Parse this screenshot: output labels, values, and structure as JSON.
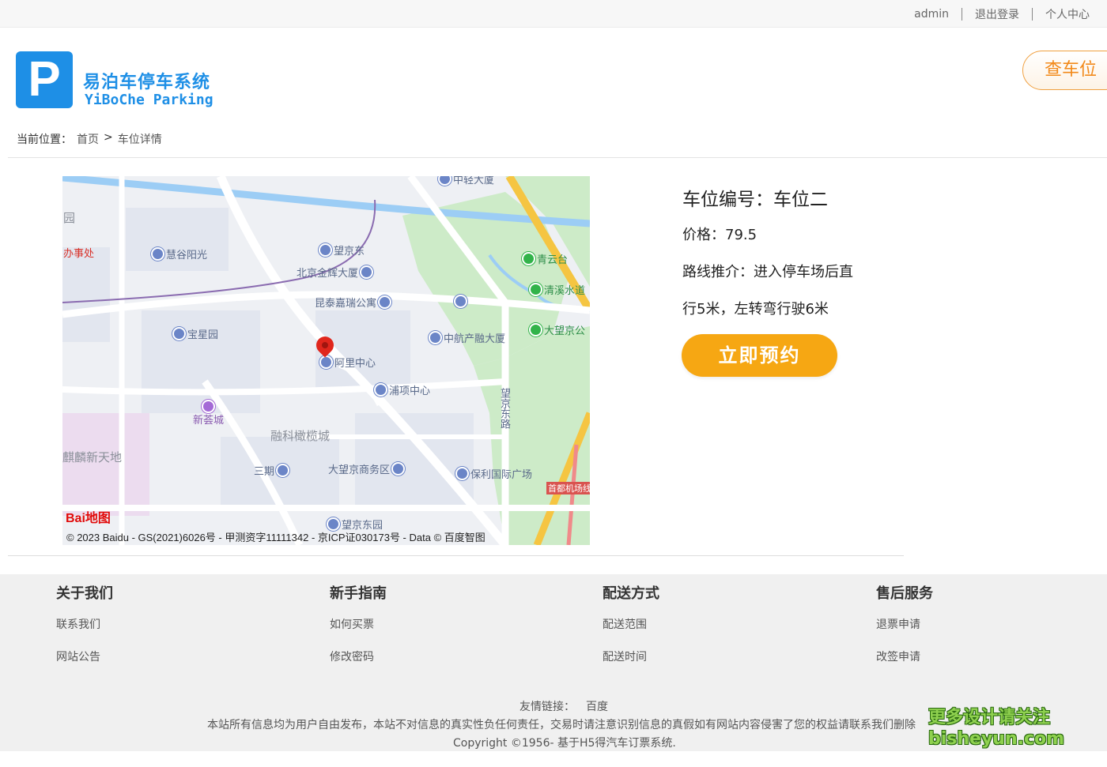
{
  "topbar": {
    "user": "admin",
    "logout": "退出登录",
    "profile": "个人中心"
  },
  "brand": {
    "logo_letter": "P",
    "name_cn": "易泊车停车系统",
    "name_en": "YiBoChe  Parking"
  },
  "header": {
    "search_button": "查车位"
  },
  "breadcrumb": {
    "prefix": "当前位置：",
    "home": "首页",
    "separator": ">",
    "current": "车位详情"
  },
  "map": {
    "brand_logo": "Bai地图",
    "copyright": "© 2023 Baidu - GS(2021)6026号 - 甲测资字11111342 - 京ICP证030173号 - Data © 百度智图",
    "pois": {
      "zhongqing": "中轻大厦",
      "wangjingdong": "望京东",
      "beijing_jinhui": "北京金辉大厦",
      "kuntai": "昆泰嘉瑞公寓",
      "huigu": "慧谷阳光",
      "banshichu": "办事处",
      "yuan": "园",
      "qingyuntai": "青云台",
      "qingxi": "清溪水道",
      "dawangjing_park": "大望京公",
      "zhonghang": "中航产融大厦",
      "baoxingyuan": "宝星园",
      "alibaba": "阿里中心",
      "puxiang": "浦项中心",
      "wangjing_road": "望京东路",
      "xinhuicheng": "新荟城",
      "rongke": "融科橄榄城",
      "qilin": "麒麟新天地",
      "sanqi": "三期",
      "dawangjing_biz": "大望京商务区",
      "baoli": "保利国际广场",
      "airport": "首都机场线",
      "wangjingdongyuan": "望京东园"
    }
  },
  "detail": {
    "title": "车位编号：车位二",
    "price": "价格：79.5",
    "route_line1": "路线推介：进入停车场后直",
    "route_line2": "行5米，左转弯行驶6米",
    "reserve_button": "立即预约"
  },
  "footer": {
    "columns": [
      {
        "title": "关于我们",
        "links": [
          "联系我们",
          "网站公告"
        ]
      },
      {
        "title": "新手指南",
        "links": [
          "如何买票",
          "修改密码"
        ]
      },
      {
        "title": "配送方式",
        "links": [
          "配送范围",
          "配送时间"
        ]
      },
      {
        "title": "售后服务",
        "links": [
          "退票申请",
          "改签申请"
        ]
      }
    ],
    "friend_label": "友情链接：",
    "friend_link": "百度",
    "disclaimer": "本站所有信息均为用户自由发布，本站不对信息的真实性负任何责任，交易时请注意识别信息的真假如有网站内容侵害了您的权益请联系我们删除",
    "copyright": "Copyright ©1956- 基于H5得汽车订票系统."
  },
  "watermark": {
    "line1": "更多设计请关注",
    "line2": "bisheyun.com"
  },
  "colors": {
    "brand_blue": "#1e8fe6",
    "accent_orange": "#f6a713",
    "search_orange": "#f28a1b"
  }
}
